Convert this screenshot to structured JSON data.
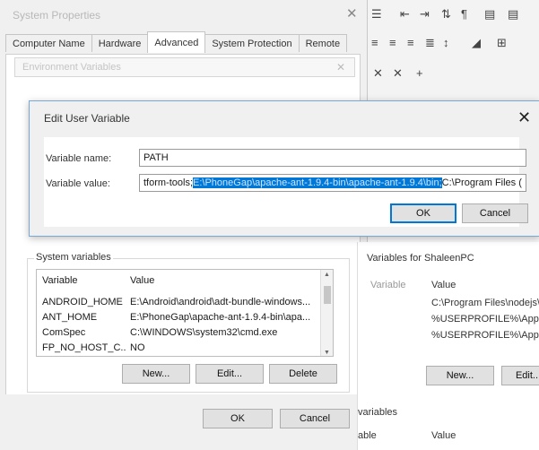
{
  "background_window": {
    "title": "System Properties",
    "tabs": [
      "Computer Name",
      "Hardware",
      "Advanced",
      "System Protection",
      "Remote"
    ],
    "active_tab": 2,
    "faded_field_text": "Environment Variables",
    "system_variables": {
      "title": "System variables",
      "columns": [
        "Variable",
        "Value"
      ],
      "rows": [
        [
          "ANDROID_HOME",
          "E:\\Android\\android\\adt-bundle-windows..."
        ],
        [
          "ANT_HOME",
          "E:\\PhoneGap\\apache-ant-1.9.4-bin\\apa..."
        ],
        [
          "ComSpec",
          "C:\\WINDOWS\\system32\\cmd.exe"
        ],
        [
          "FP_NO_HOST_C...",
          "NO"
        ]
      ],
      "buttons": {
        "new": "New...",
        "edit": "Edit...",
        "delete": "Delete"
      }
    },
    "footer_buttons": {
      "ok": "OK",
      "cancel": "Cancel"
    }
  },
  "right_window": {
    "user_vars_title": "Variables for ShaleenPC",
    "columns": [
      "Variable",
      "Value"
    ],
    "values": [
      "C:\\Program Files\\nodejs\\",
      "%USERPROFILE%\\AppD",
      "%USERPROFILE%\\AppD"
    ],
    "buttons": {
      "new": "New...",
      "edit": "Edit..."
    },
    "lower_title": "variables",
    "lower_columns": [
      "able",
      "Value"
    ]
  },
  "dialog": {
    "title": "Edit User Variable",
    "variable_name_label": "Variable name:",
    "variable_name_value": "PATH",
    "variable_value_label": "Variable value:",
    "value_prefix": "tform-tools;",
    "value_selected": "E:\\PhoneGap\\apache-ant-1.9.4-bin\\apache-ant-1.9.4\\bin;",
    "value_suffix": "C:\\Program Files (",
    "buttons": {
      "ok": "OK",
      "cancel": "Cancel"
    }
  },
  "colors": {
    "accent": "#0078d7",
    "dialog_border": "#7aa7d8"
  }
}
